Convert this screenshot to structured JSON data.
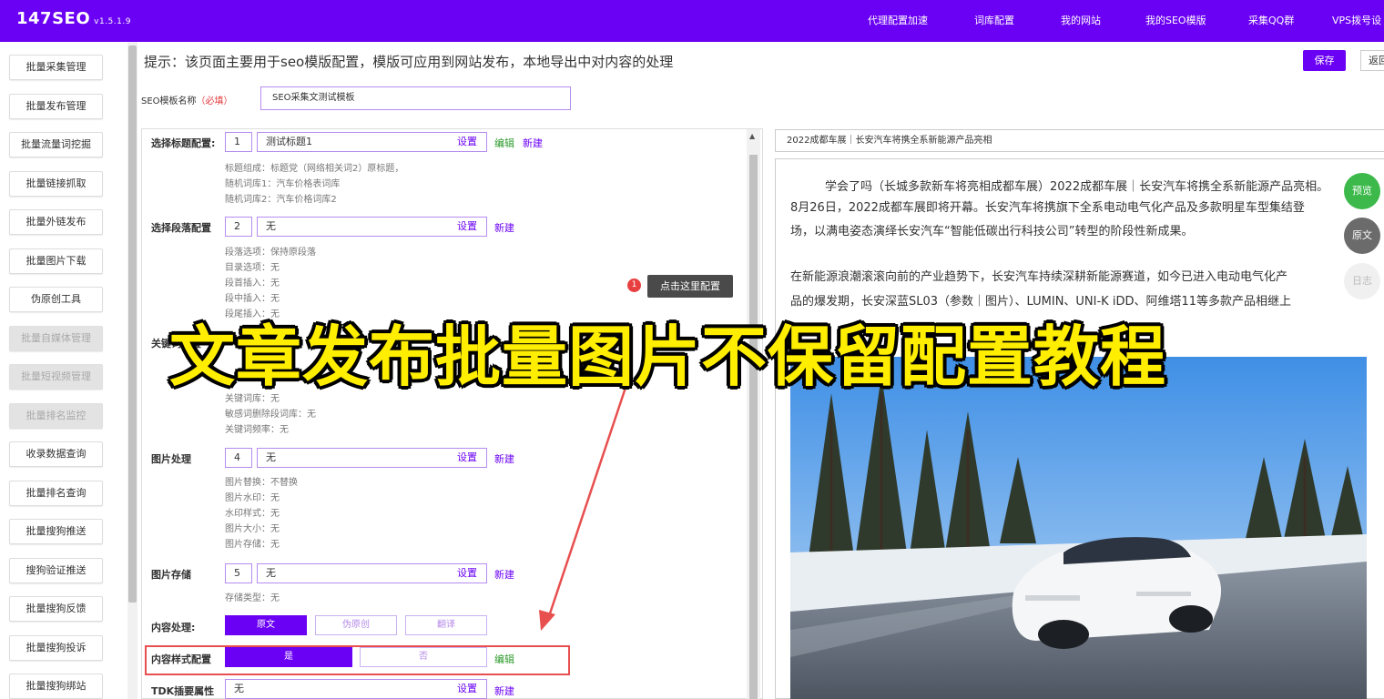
{
  "app": {
    "brand": "147SEO",
    "version": "v1.5.1.9"
  },
  "topnav": [
    "代理配置加速",
    "词库配置",
    "我的网站",
    "我的SEO模版",
    "采集QQ群",
    "VPS拨号设"
  ],
  "sidebar": {
    "items": [
      {
        "label": "批量采集管理",
        "disabled": false
      },
      {
        "label": "批量发布管理",
        "disabled": false
      },
      {
        "label": "批量流量词挖掘",
        "disabled": false
      },
      {
        "label": "批量链接抓取",
        "disabled": false
      },
      {
        "label": "批量外链发布",
        "disabled": false
      },
      {
        "label": "批量图片下载",
        "disabled": false
      },
      {
        "label": "伪原创工具",
        "disabled": false
      },
      {
        "label": "批量自媒体管理",
        "disabled": true
      },
      {
        "label": "批量短视频管理",
        "disabled": true
      },
      {
        "label": "批量排名监控",
        "disabled": true
      },
      {
        "label": "收录数据查询",
        "disabled": false
      },
      {
        "label": "批量排名查询",
        "disabled": false
      },
      {
        "label": "批量搜狗推送",
        "disabled": false
      },
      {
        "label": "搜狗验证推送",
        "disabled": false
      },
      {
        "label": "批量搜狗反馈",
        "disabled": false
      },
      {
        "label": "批量搜狗投诉",
        "disabled": false
      },
      {
        "label": "批量搜狗绑站",
        "disabled": false
      }
    ]
  },
  "header": {
    "hint": "提示：该页面主要用于seo模版配置，模版可应用到网站发布，本地导出中对内容的处理",
    "save": "保存",
    "back": "返回",
    "template_label": "SEO模板名称",
    "template_required": "（必填）",
    "template_value": "SEO采集文测试模板"
  },
  "config": {
    "title_row": {
      "label": "选择标题配置:",
      "num": "1",
      "value": "测试标题1",
      "set": "设置",
      "edit": "编辑",
      "new": "新建",
      "details": [
        "标题组成：标题党（网络相关词2）原标题，",
        "随机词库1：汽车价格表词库",
        "随机词库2：汽车价格词库2"
      ]
    },
    "para_row": {
      "label": "选择段落配置",
      "num": "2",
      "value": "无",
      "set": "设置",
      "new": "新建",
      "details": [
        "段落选项：保持原段落",
        "目录选项：无",
        "段首插入：无",
        "段中插入：无",
        "段尾插入：无"
      ]
    },
    "keyword_row": {
      "label": "关键词配置",
      "details": [
        "关键词库：无",
        "敏感词删除段词库：无",
        "关键词频率：无"
      ]
    },
    "image_row": {
      "label": "图片处理",
      "num": "4",
      "value": "无",
      "set": "设置",
      "new": "新建",
      "details": [
        "图片替换：不替换",
        "图片水印：无",
        "水印样式：无",
        "图片大小：无",
        "图片存储：无"
      ]
    },
    "storage_row": {
      "label": "图片存储",
      "num": "5",
      "value": "无",
      "set": "设置",
      "new": "新建",
      "details": [
        "存储类型：无"
      ]
    },
    "content_row": {
      "label": "内容处理:",
      "options": [
        "原文",
        "伪原创",
        "翻译"
      ]
    },
    "style_row": {
      "label": "内容样式配置",
      "yes": "是",
      "no": "否",
      "edit": "编辑"
    },
    "tdk_row": {
      "label": "TDK插要属性",
      "value": "无",
      "set": "设置",
      "new": "新建"
    },
    "badge": "1",
    "tip": "点击这里配置"
  },
  "preview": {
    "title": "2022成都车展｜长安汽车将携全系新能源产品亮相",
    "lines": [
      "学会了吗（长城多款新车将亮相成都车展）2022成都车展｜长安汽车将携全系新能源产品亮相。",
      "8月26日，2022成都车展即将开幕。长安汽车将携旗下全系电动电气化产品及多款明星车型集结登",
      "场，以满电姿态演绎长安汽车“智能低碳出行科技公司”转型的阶段性新成果。",
      "在新能源浪潮滚滚向前的产业趋势下，长安汽车持续深耕新能源赛道，如今已进入电动电气化产",
      "品的爆发期，长安深蓝SL03（参数｜图片）、LUMIN、UNI-K iDD、阿维塔11等多款产品相继上"
    ],
    "buttons": [
      "预览",
      "原文",
      "日志"
    ]
  },
  "overlay": {
    "title": "文章发布批量图片不保留配置教程"
  },
  "colors": {
    "primary": "#6a00f4",
    "green": "#2c9a2c",
    "red": "#e84f4f",
    "overlay_yellow": "#ffee00"
  }
}
